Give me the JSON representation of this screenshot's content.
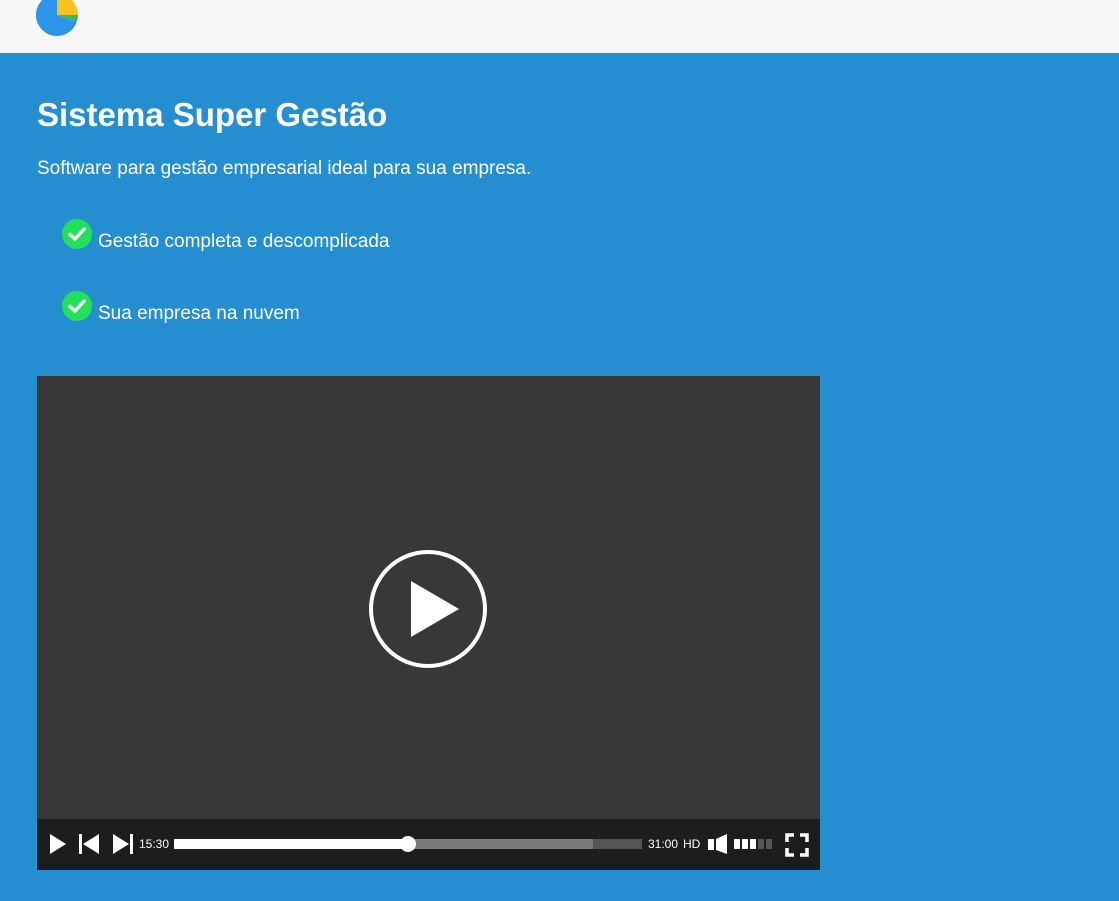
{
  "brand": {
    "logo_icon": "pie-chart-icon",
    "colors": {
      "blue": "#2d95e8",
      "yellow": "#f7c21b",
      "green": "#3cba54"
    }
  },
  "hero": {
    "title": "Sistema Super Gestão",
    "subtitle": "Software para gestão empresarial ideal para sua empresa.",
    "background_color": "#258ed1",
    "features": [
      {
        "icon": "check-circle-icon",
        "label": "Gestão completa e descomplicada"
      },
      {
        "icon": "check-circle-icon",
        "label": "Sua empresa na nuvem"
      }
    ],
    "check_color": "#22e05a"
  },
  "video": {
    "current_time": "15:30",
    "duration": "31:00",
    "quality": "HD",
    "progress_fraction": 0.5,
    "buffered_fraction": 0.895,
    "volume_level": 3,
    "volume_max": 5
  }
}
